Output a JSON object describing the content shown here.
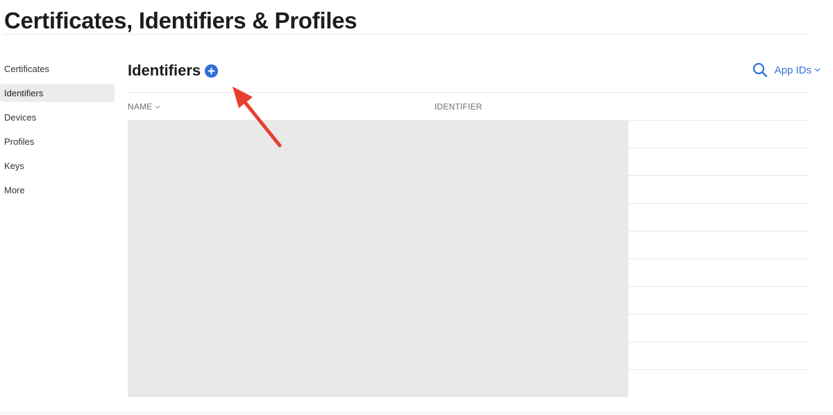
{
  "page": {
    "title": "Certificates, Identifiers & Profiles"
  },
  "sidebar": {
    "items": [
      {
        "label": "Certificates",
        "active": false
      },
      {
        "label": "Identifiers",
        "active": true
      },
      {
        "label": "Devices",
        "active": false
      },
      {
        "label": "Profiles",
        "active": false
      },
      {
        "label": "Keys",
        "active": false
      },
      {
        "label": "More",
        "active": false
      }
    ]
  },
  "main": {
    "section_title": "Identifiers",
    "add_button_icon": "plus-circle-icon",
    "search_icon": "search-icon",
    "filter_label": "App IDs",
    "table": {
      "columns": [
        "NAME",
        "IDENTIFIER"
      ],
      "row_count": 10,
      "rows_redacted": true
    }
  },
  "annotation": {
    "type": "arrow",
    "color": "#e8402f",
    "points_to": "add-identifier-button"
  },
  "colors": {
    "accent": "#2f6fd6",
    "annotation_red": "#e8402f",
    "redaction_gray": "#e9e9e9"
  }
}
